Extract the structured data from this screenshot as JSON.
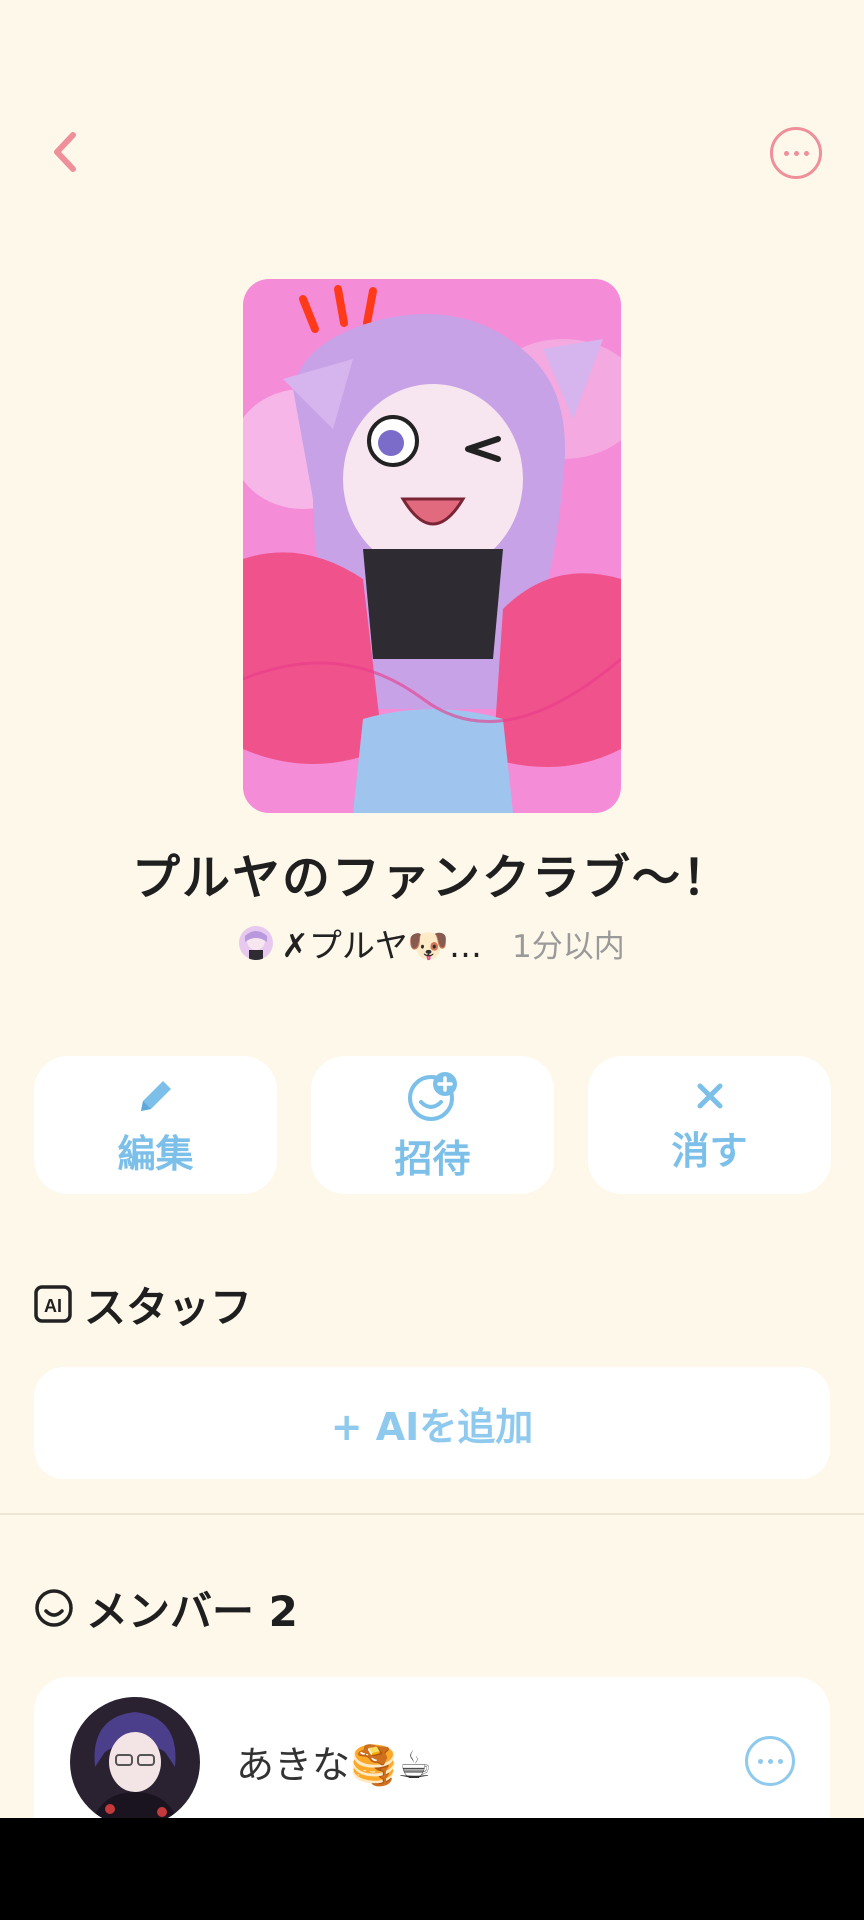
{
  "header": {
    "back_icon": "chevron-left-icon",
    "more_icon": "more-horizontal-icon"
  },
  "club": {
    "title": "プルヤのファンクラブ〜！",
    "owner_name": "✗プルヤ🐶…",
    "updated": "1分以内"
  },
  "actions": [
    {
      "label": "編集",
      "icon": "pencil-icon"
    },
    {
      "label": "招待",
      "icon": "invite-smile-plus-icon"
    },
    {
      "label": "消す",
      "icon": "close-icon"
    }
  ],
  "staff": {
    "heading": "スタッフ",
    "add_ai_label": "+ AIを追加"
  },
  "members": {
    "heading": "メンバー 2",
    "list": [
      {
        "name": "あきな🥞☕"
      }
    ]
  },
  "colors": {
    "background": "#FDF8EA",
    "accent_pink": "#EE8F9A",
    "accent_blue": "#7CC0EA",
    "card": "#FFFFFF"
  }
}
